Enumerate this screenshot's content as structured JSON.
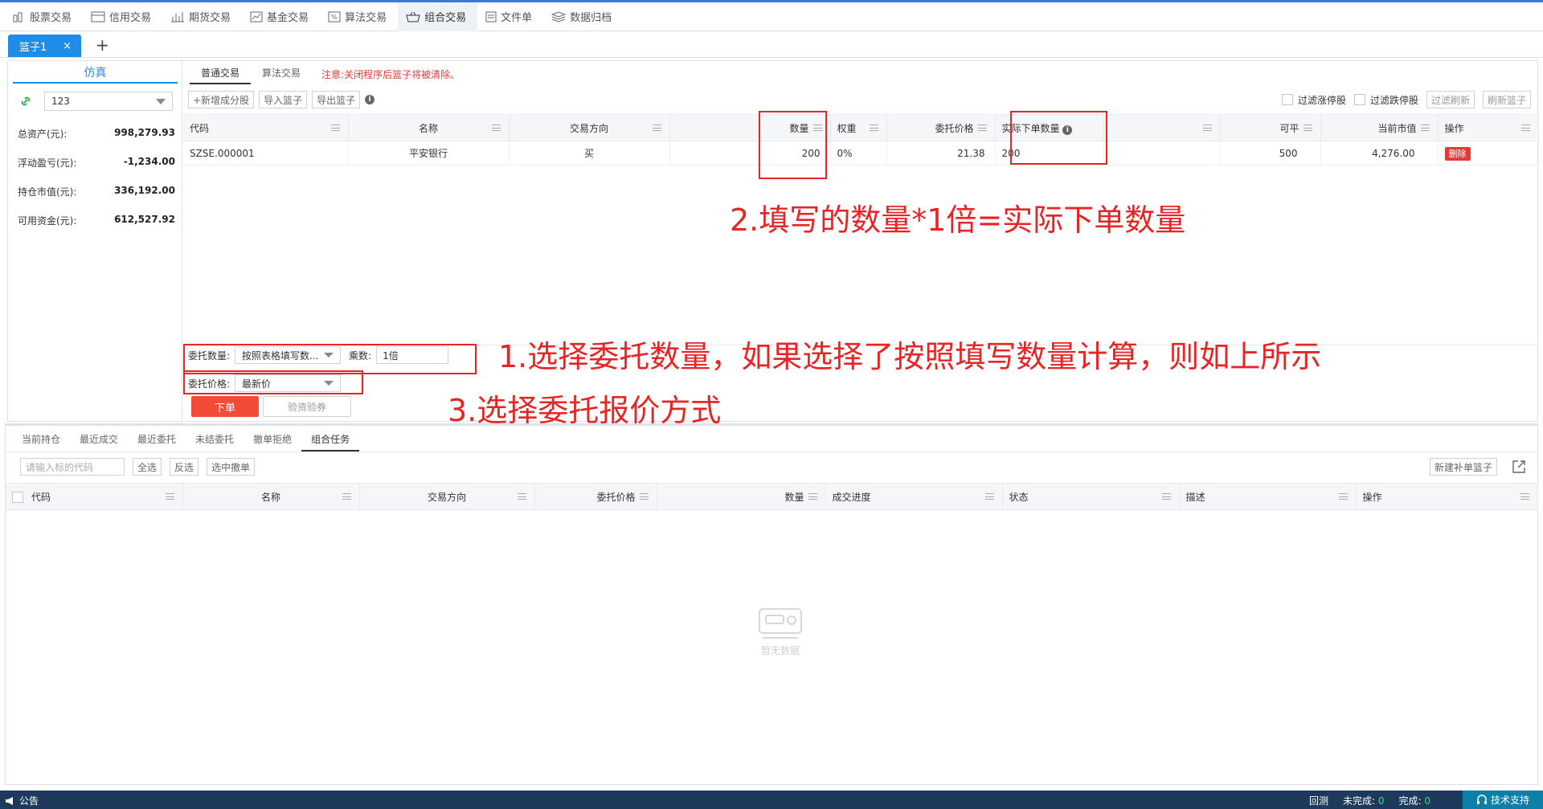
{
  "nav": {
    "items": [
      {
        "label": "股票交易",
        "icon": "stock-icon"
      },
      {
        "label": "信用交易",
        "icon": "credit-icon"
      },
      {
        "label": "期货交易",
        "icon": "futures-icon"
      },
      {
        "label": "基金交易",
        "icon": "fund-icon"
      },
      {
        "label": "算法交易",
        "icon": "algo-icon"
      },
      {
        "label": "组合交易",
        "icon": "basket-icon"
      },
      {
        "label": "文件单",
        "icon": "file-icon"
      },
      {
        "label": "数据归档",
        "icon": "archive-icon"
      }
    ]
  },
  "tabs": {
    "basket": "篮子1",
    "close": "×",
    "add": "+"
  },
  "left": {
    "mode_tab": "仿真",
    "account_value": "123",
    "stats": [
      {
        "label": "总资产(元):",
        "value": "998,279.93"
      },
      {
        "label": "浮动盈亏(元):",
        "value": "-1,234.00"
      },
      {
        "label": "持仓市值(元):",
        "value": "336,192.00"
      },
      {
        "label": "可用资金(元):",
        "value": "612,527.92"
      }
    ]
  },
  "main": {
    "subtabs": [
      "普通交易",
      "算法交易"
    ],
    "notice": "注意:关闭程序后篮子将被清除。",
    "toolbar": {
      "add": "+新增成分股",
      "import": "导入篮子",
      "export": "导出篮子"
    },
    "filters": {
      "limit_up": "过滤涨停股",
      "limit_down": "过滤跌停股",
      "filter_refresh": "过滤刷新",
      "refresh_basket": "刷新篮子"
    },
    "columns": [
      "代码",
      "名称",
      "交易方向",
      "数量",
      "权重",
      "委托价格",
      "实际下单数量",
      "可平",
      "当前市值",
      "操作"
    ],
    "rows": [
      {
        "code": "SZSE.000001",
        "name": "平安银行",
        "direction": "买",
        "qty": "200",
        "weight": "0%",
        "price": "21.38",
        "actual_qty": "200",
        "closable": "500",
        "market_value": "4,276.00",
        "action": "删除"
      }
    ],
    "entrust": {
      "qty_label": "委托数量:",
      "qty_value": "按照表格填写数...",
      "mult_label": "乘数:",
      "mult_value": "1倍",
      "price_label": "委托价格:",
      "price_value": "最新价"
    },
    "order_btn": "下单",
    "verify_btn": "验资验券"
  },
  "annotations": {
    "a1": "1.选择委托数量，如果选择了按照填写数量计算，则如上所示",
    "a2": "2.填写的数量*1倍=实际下单数量",
    "a3": "3.选择委托报价方式"
  },
  "lower": {
    "tabs": [
      "当前持仓",
      "最近成交",
      "最近委托",
      "未结委托",
      "撤单拒绝",
      "组合任务"
    ],
    "search_placeholder": "请输入标的代码",
    "buttons": {
      "all": "全选",
      "invert": "反选",
      "cancel": "选中撤单",
      "new_basket": "新建补单篮子"
    },
    "columns": [
      "代码",
      "名称",
      "交易方向",
      "委托价格",
      "数量",
      "成交进度",
      "状态",
      "描述",
      "操作"
    ],
    "empty_text": "暂无数据"
  },
  "status": {
    "announcement": "公告",
    "replay": "回测",
    "unfinished_label": "未完成:",
    "unfinished": "0",
    "finished_label": "完成:",
    "finished": "0",
    "support": "技术支持"
  }
}
